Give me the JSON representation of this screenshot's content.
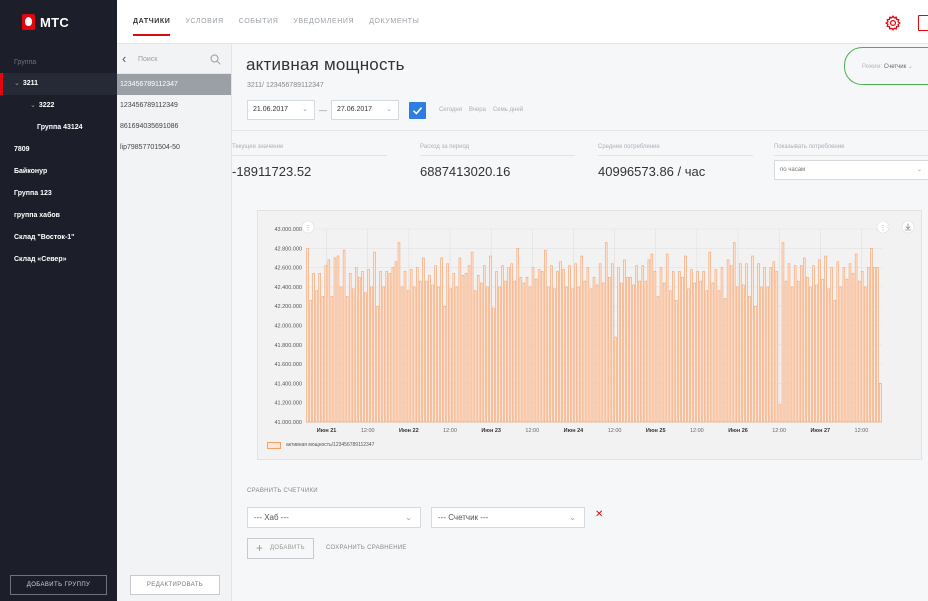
{
  "brand": {
    "logo_text": "МТС",
    "accent": "#e30611"
  },
  "nav": {
    "tabs": [
      {
        "label": "датчики"
      },
      {
        "label": "условия"
      },
      {
        "label": "события"
      },
      {
        "label": "уведомления"
      },
      {
        "label": "документы"
      }
    ],
    "right_icons": [
      "gear-icon",
      "logout-icon"
    ]
  },
  "sidebar": {
    "header": "Группа",
    "items": [
      {
        "label": "3211"
      },
      {
        "label": "3222"
      },
      {
        "label": "Группа 43124"
      },
      {
        "label": "7809"
      },
      {
        "label": "Байконур"
      },
      {
        "label": "Группа 123"
      },
      {
        "label": "группа хабов"
      },
      {
        "label": "Склад \"Восток-1\""
      },
      {
        "label": "Склад «Север»"
      }
    ],
    "add_group_label": "добавить группу"
  },
  "devices": {
    "search_placeholder": "Поиск",
    "items": [
      {
        "label": "123456789112347"
      },
      {
        "label": "123456789112349"
      },
      {
        "label": "861694035691086"
      },
      {
        "label": "lip79857701504-50"
      }
    ],
    "edit_label": "редактировать"
  },
  "main": {
    "title": "активная мощность",
    "subtitle": "3211/ 123456789112347",
    "mode_label": "Режим:",
    "mode_value": "Счетчик",
    "date_from": "21.06.2017",
    "date_to": "27.06.2017",
    "date_sep": "—",
    "quick_links": [
      "Сегодня",
      "Вчера",
      "Семь дней"
    ],
    "stats": [
      {
        "label": "Текущее значение",
        "value": "-18911723.52"
      },
      {
        "label": "Расход за период",
        "value": "6887413020.16"
      },
      {
        "label": "Среднее потребление",
        "value": "40996573.86 / час"
      }
    ],
    "show_consumption_label": "Показывать потребление",
    "show_consumption_value": "по часам",
    "compare_title": "сравнить счетчики",
    "hub_select": "--- Хаб ---",
    "counter_select": "--- Счетчик ---",
    "add_label": "добавить",
    "save_compare_label": "сохранить сравнение"
  },
  "chart_data": {
    "type": "bar",
    "series": [
      {
        "name": "активная мощность/123456789112347",
        "color": "#f5a06a",
        "values": [
          42800000,
          42260000,
          42540000,
          42360000,
          42540000,
          42300000,
          42620000,
          42680000,
          42300000,
          42700000,
          42720000,
          42400000,
          42780000,
          42300000,
          42540000,
          42380000,
          42600000,
          42500000,
          42560000,
          42340000,
          42580000,
          42400000,
          42760000,
          42200000,
          42560000,
          42400000,
          42560000,
          42540000,
          42600000,
          42660000,
          42860000,
          42400000,
          42560000,
          42360000,
          42580000,
          42400000,
          42600000,
          42460000,
          42700000,
          42460000,
          42520000,
          42420000,
          42620000,
          42400000,
          42700000,
          42200000,
          42640000,
          42380000,
          42540000,
          42400000,
          42700000,
          42520000,
          42540000,
          42620000,
          42760000,
          42360000,
          42520000,
          42440000,
          42620000,
          42400000,
          42720000,
          42180000,
          42560000,
          42400000,
          42620000,
          42460000,
          42600000,
          42640000,
          42460000,
          42800000,
          42500000,
          42440000,
          42500000,
          42400000,
          42600000,
          42480000,
          42580000,
          42560000,
          42780000,
          42400000,
          42620000,
          42380000,
          42560000,
          42660000,
          42580000,
          42400000,
          42620000,
          42380000,
          42640000,
          42400000,
          42720000,
          42460000,
          42600000,
          42380000,
          42500000,
          42420000,
          42640000,
          42440000,
          42860000,
          42500000,
          42640000,
          41880000,
          42600000,
          42440000,
          42680000,
          42500000,
          42500000,
          42420000,
          42620000,
          42460000,
          42620000,
          42460000,
          42680000,
          42740000,
          42560000,
          42300000,
          42600000,
          42440000,
          42740000,
          42360000,
          42560000,
          42260000,
          42560000,
          42500000,
          42720000,
          42380000,
          42580000,
          42440000,
          42560000,
          42460000,
          42560000,
          42360000,
          42760000,
          42440000,
          42580000,
          42360000,
          42600000,
          42280000,
          42680000,
          42620000,
          42860000,
          42400000,
          42640000,
          42420000,
          42640000,
          42300000,
          42720000,
          42200000,
          42640000,
          42400000,
          42600000,
          42400000,
          42600000,
          42660000,
          42560000,
          41180000,
          42860000,
          42460000,
          42640000,
          42400000,
          42620000,
          42460000,
          42620000,
          42700000,
          42500000,
          42400000,
          42620000,
          42420000,
          42680000,
          42480000,
          42720000,
          42380000,
          42600000,
          42260000,
          42660000,
          42400000,
          42600000,
          42480000,
          42640000,
          42540000,
          42740000,
          42460000,
          42560000,
          42400000,
          42600000,
          42800000,
          42600000,
          42600000,
          41400000
        ]
      }
    ],
    "x_ticks": [
      {
        "label": "Июн 21",
        "bold": true
      },
      {
        "label": "12:00",
        "bold": false
      },
      {
        "label": "Июн 22",
        "bold": true
      },
      {
        "label": "12:00",
        "bold": false
      },
      {
        "label": "Июн 23",
        "bold": true
      },
      {
        "label": "12:00",
        "bold": false
      },
      {
        "label": "Июн 24",
        "bold": true
      },
      {
        "label": "12:00",
        "bold": false
      },
      {
        "label": "Июн 25",
        "bold": true
      },
      {
        "label": "12:00",
        "bold": false
      },
      {
        "label": "Июн 26",
        "bold": true
      },
      {
        "label": "12:00",
        "bold": false
      },
      {
        "label": "Июн 27",
        "bold": true
      },
      {
        "label": "12:00",
        "bold": false
      }
    ],
    "y_ticks": [
      "43.000.000",
      "42.800.000",
      "42.600.000",
      "42.400.000",
      "42.200.000",
      "42.000.000",
      "41.800.000",
      "41.600.000",
      "41.400.000",
      "41.200.000",
      "41.000.000"
    ],
    "ylim": [
      41000000,
      43000000
    ],
    "grid": true,
    "legend": "bottom-left"
  }
}
